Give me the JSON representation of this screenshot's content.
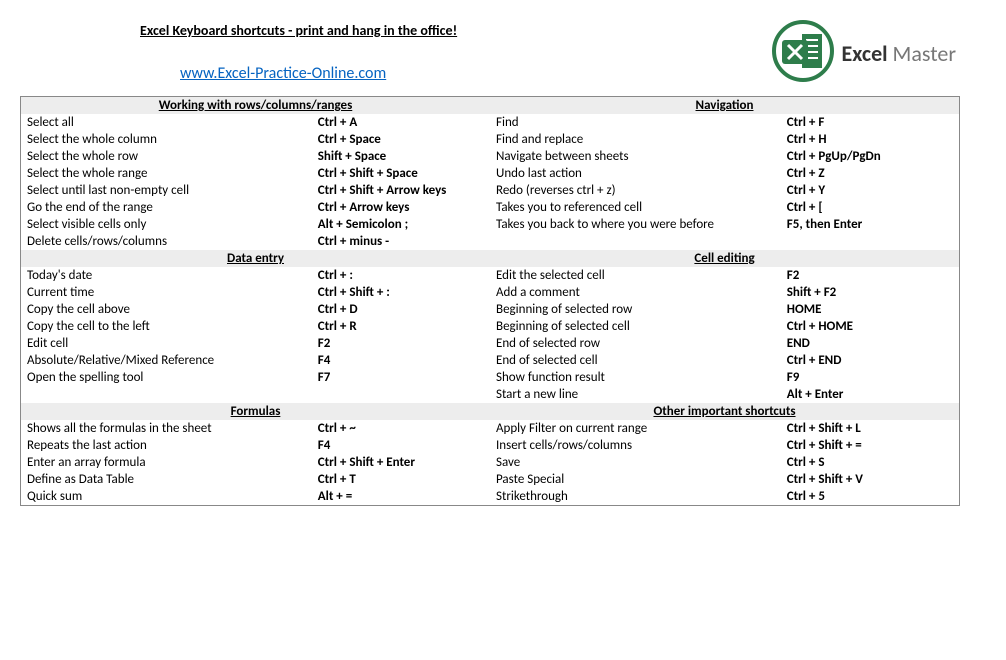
{
  "header": {
    "title": "Excel Keyboard shortcuts - print and hang in the office!",
    "link": "www.Excel-Practice-Online.com",
    "logo_excel": "Excel",
    "logo_master": " Master"
  },
  "sections": {
    "rows": {
      "title": "Working with rows/columns/ranges",
      "items": [
        {
          "desc": "Select all",
          "key": "Ctrl + A"
        },
        {
          "desc": "Select the whole column",
          "key": "Ctrl + Space"
        },
        {
          "desc": "Select the whole row",
          "key": "Shift + Space"
        },
        {
          "desc": "Select the whole range",
          "key": "Ctrl + Shift + Space"
        },
        {
          "desc": "Select until last non-empty cell",
          "key": "Ctrl + Shift + Arrow keys"
        },
        {
          "desc": "Go the end of the range",
          "key": "Ctrl + Arrow keys"
        },
        {
          "desc": "Select visible cells only",
          "key": "Alt + Semicolon ;"
        },
        {
          "desc": "Delete cells/rows/columns",
          "key": "Ctrl + minus -"
        }
      ]
    },
    "nav": {
      "title": "Navigation",
      "items": [
        {
          "desc": "Find",
          "key": "Ctrl + F"
        },
        {
          "desc": "Find and replace",
          "key": "Ctrl + H"
        },
        {
          "desc": "Navigate between sheets",
          "key": "Ctrl + PgUp/PgDn"
        },
        {
          "desc": "Undo last action",
          "key": "Ctrl + Z"
        },
        {
          "desc": "Redo (reverses ctrl + z)",
          "key": "Ctrl + Y"
        },
        {
          "desc": "Takes you to referenced cell",
          "key": "Ctrl + ["
        },
        {
          "desc": "Takes you back to where you were before",
          "key": "F5, then Enter"
        }
      ]
    },
    "data": {
      "title": "Data entry",
      "items": [
        {
          "desc": "Today's date",
          "key": "Ctrl + :"
        },
        {
          "desc": "Current time",
          "key": "Ctrl + Shift + :"
        },
        {
          "desc": "Copy the cell above",
          "key": "Ctrl + D"
        },
        {
          "desc": "Copy the cell to the left",
          "key": "Ctrl + R"
        },
        {
          "desc": "Edit cell",
          "key": "F2"
        },
        {
          "desc": "Absolute/Relative/Mixed Reference",
          "key": "F4"
        },
        {
          "desc": "Open the spelling tool",
          "key": "F7"
        }
      ]
    },
    "cell": {
      "title": "Cell editing",
      "items": [
        {
          "desc": "Edit the selected cell",
          "key": "F2"
        },
        {
          "desc": "Add a comment",
          "key": "Shift + F2"
        },
        {
          "desc": "Beginning of selected row",
          "key": "HOME"
        },
        {
          "desc": "Beginning of selected cell",
          "key": "Ctrl + HOME"
        },
        {
          "desc": "End of selected row",
          "key": "END"
        },
        {
          "desc": "End of selected cell",
          "key": "Ctrl + END"
        },
        {
          "desc": "Show function result",
          "key": "F9"
        },
        {
          "desc": "Start a new line",
          "key": "Alt + Enter"
        }
      ]
    },
    "formulas": {
      "title": "Formulas",
      "items": [
        {
          "desc": "Shows all the formulas in the sheet",
          "key": "Ctrl + ~"
        },
        {
          "desc": "Repeats the last action",
          "key": "F4"
        },
        {
          "desc": "Enter an array formula",
          "key": "Ctrl + Shift + Enter"
        },
        {
          "desc": "Define as Data Table",
          "key": "Ctrl + T"
        },
        {
          "desc": "Quick sum",
          "key": "Alt + ="
        }
      ]
    },
    "other": {
      "title": "Other important shortcuts",
      "items": [
        {
          "desc": "Apply Filter on current range",
          "key": "Ctrl + Shift + L"
        },
        {
          "desc": "Insert cells/rows/columns",
          "key": "Ctrl + Shift + ="
        },
        {
          "desc": "Save",
          "key": "Ctrl + S"
        },
        {
          "desc": "Paste Special",
          "key": "Ctrl + Shift + V"
        },
        {
          "desc": "Strikethrough",
          "key": "Ctrl + 5"
        }
      ]
    }
  }
}
